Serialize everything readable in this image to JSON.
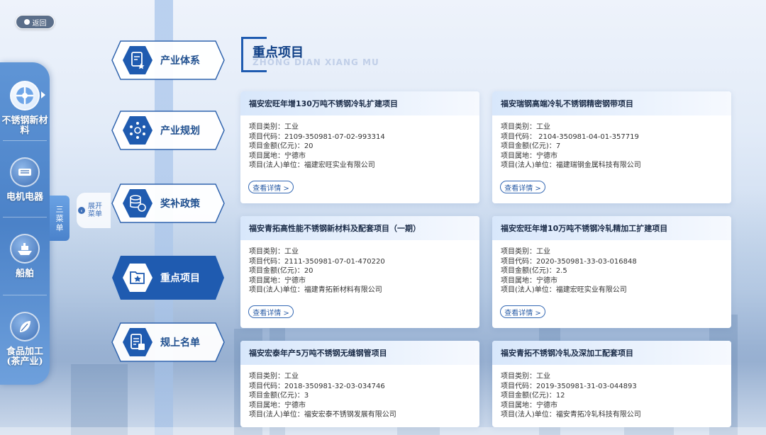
{
  "back_label": "返回",
  "menu": {
    "toggle_label": [
      "三",
      "菜",
      "单"
    ],
    "expand_label": "展开菜单"
  },
  "categories": [
    {
      "label": "不锈钢新材料",
      "icon": "steel-icon",
      "active": true
    },
    {
      "label": "电机电器",
      "icon": "motor-icon",
      "active": false
    },
    {
      "label": "船舶",
      "icon": "ship-icon",
      "active": false
    },
    {
      "label": "食品加工(茶产业)",
      "icon": "leaf-icon",
      "active": false
    }
  ],
  "nav": [
    {
      "label": "产业体系",
      "icon": "document-star-icon",
      "active": false
    },
    {
      "label": "产业规划",
      "icon": "network-icon",
      "active": false
    },
    {
      "label": "奖补政策",
      "icon": "coins-icon",
      "active": false
    },
    {
      "label": "重点项目",
      "icon": "folder-star-icon",
      "active": true
    },
    {
      "label": "规上名单",
      "icon": "list-enterprise-icon",
      "active": false
    }
  ],
  "section": {
    "title": "重点项目",
    "pinyin": "ZHONG DIAN XIANG MU"
  },
  "field_labels": {
    "type": "项目类别：",
    "code": "项目代码：",
    "amount": "项目金额(亿元)：",
    "location": "项目属地：",
    "owner": "项目(法人)单位："
  },
  "detail_label": "查看详情 >",
  "projects": [
    {
      "title": "福安宏旺年增130万吨不锈钢冷轧扩建项目",
      "type": "工业",
      "code": "2109-350981-07-02-993314",
      "amount": "20",
      "location": "宁德市",
      "owner": "福建宏旺实业有限公司"
    },
    {
      "title": "福安瑞钢高端冷轧不锈钢精密钢带项目",
      "type": "工业",
      "code": " 2104-350981-04-01-357719",
      "amount": "7",
      "location": "宁德市",
      "owner": "福建瑞钢金属科技有限公司"
    },
    {
      "title": "福安青拓高性能不锈钢新材料及配套项目（一期）",
      "type": "工业",
      "code": "2111-350981-07-01-470220",
      "amount": "20",
      "location": "宁德市",
      "owner": "福建青拓新材料有限公司"
    },
    {
      "title": "福安宏旺年增10万吨不锈钢冷轧精加工扩建项目",
      "type": "工业",
      "code": "2020-350981-33-03-016848",
      "amount": "2.5",
      "location": "宁德市",
      "owner": "福建宏旺实业有限公司"
    },
    {
      "title": "福安宏泰年产5万吨不锈钢无缝钢管项目",
      "type": "工业",
      "code": "2018-350981-32-03-034746",
      "amount": "3",
      "location": "宁德市",
      "owner": "福安宏泰不锈钢发展有限公司"
    },
    {
      "title": "福安青拓不锈钢冷轧及深加工配套项目",
      "type": "工业",
      "code": "2019-350981-31-03-044893",
      "amount": "12",
      "location": "宁德市",
      "owner": "福安青拓冷轧科技有限公司"
    }
  ],
  "colors": {
    "primary": "#1f5bb0",
    "nav_active": "#1f5bb0",
    "title": "#0f3f86"
  }
}
